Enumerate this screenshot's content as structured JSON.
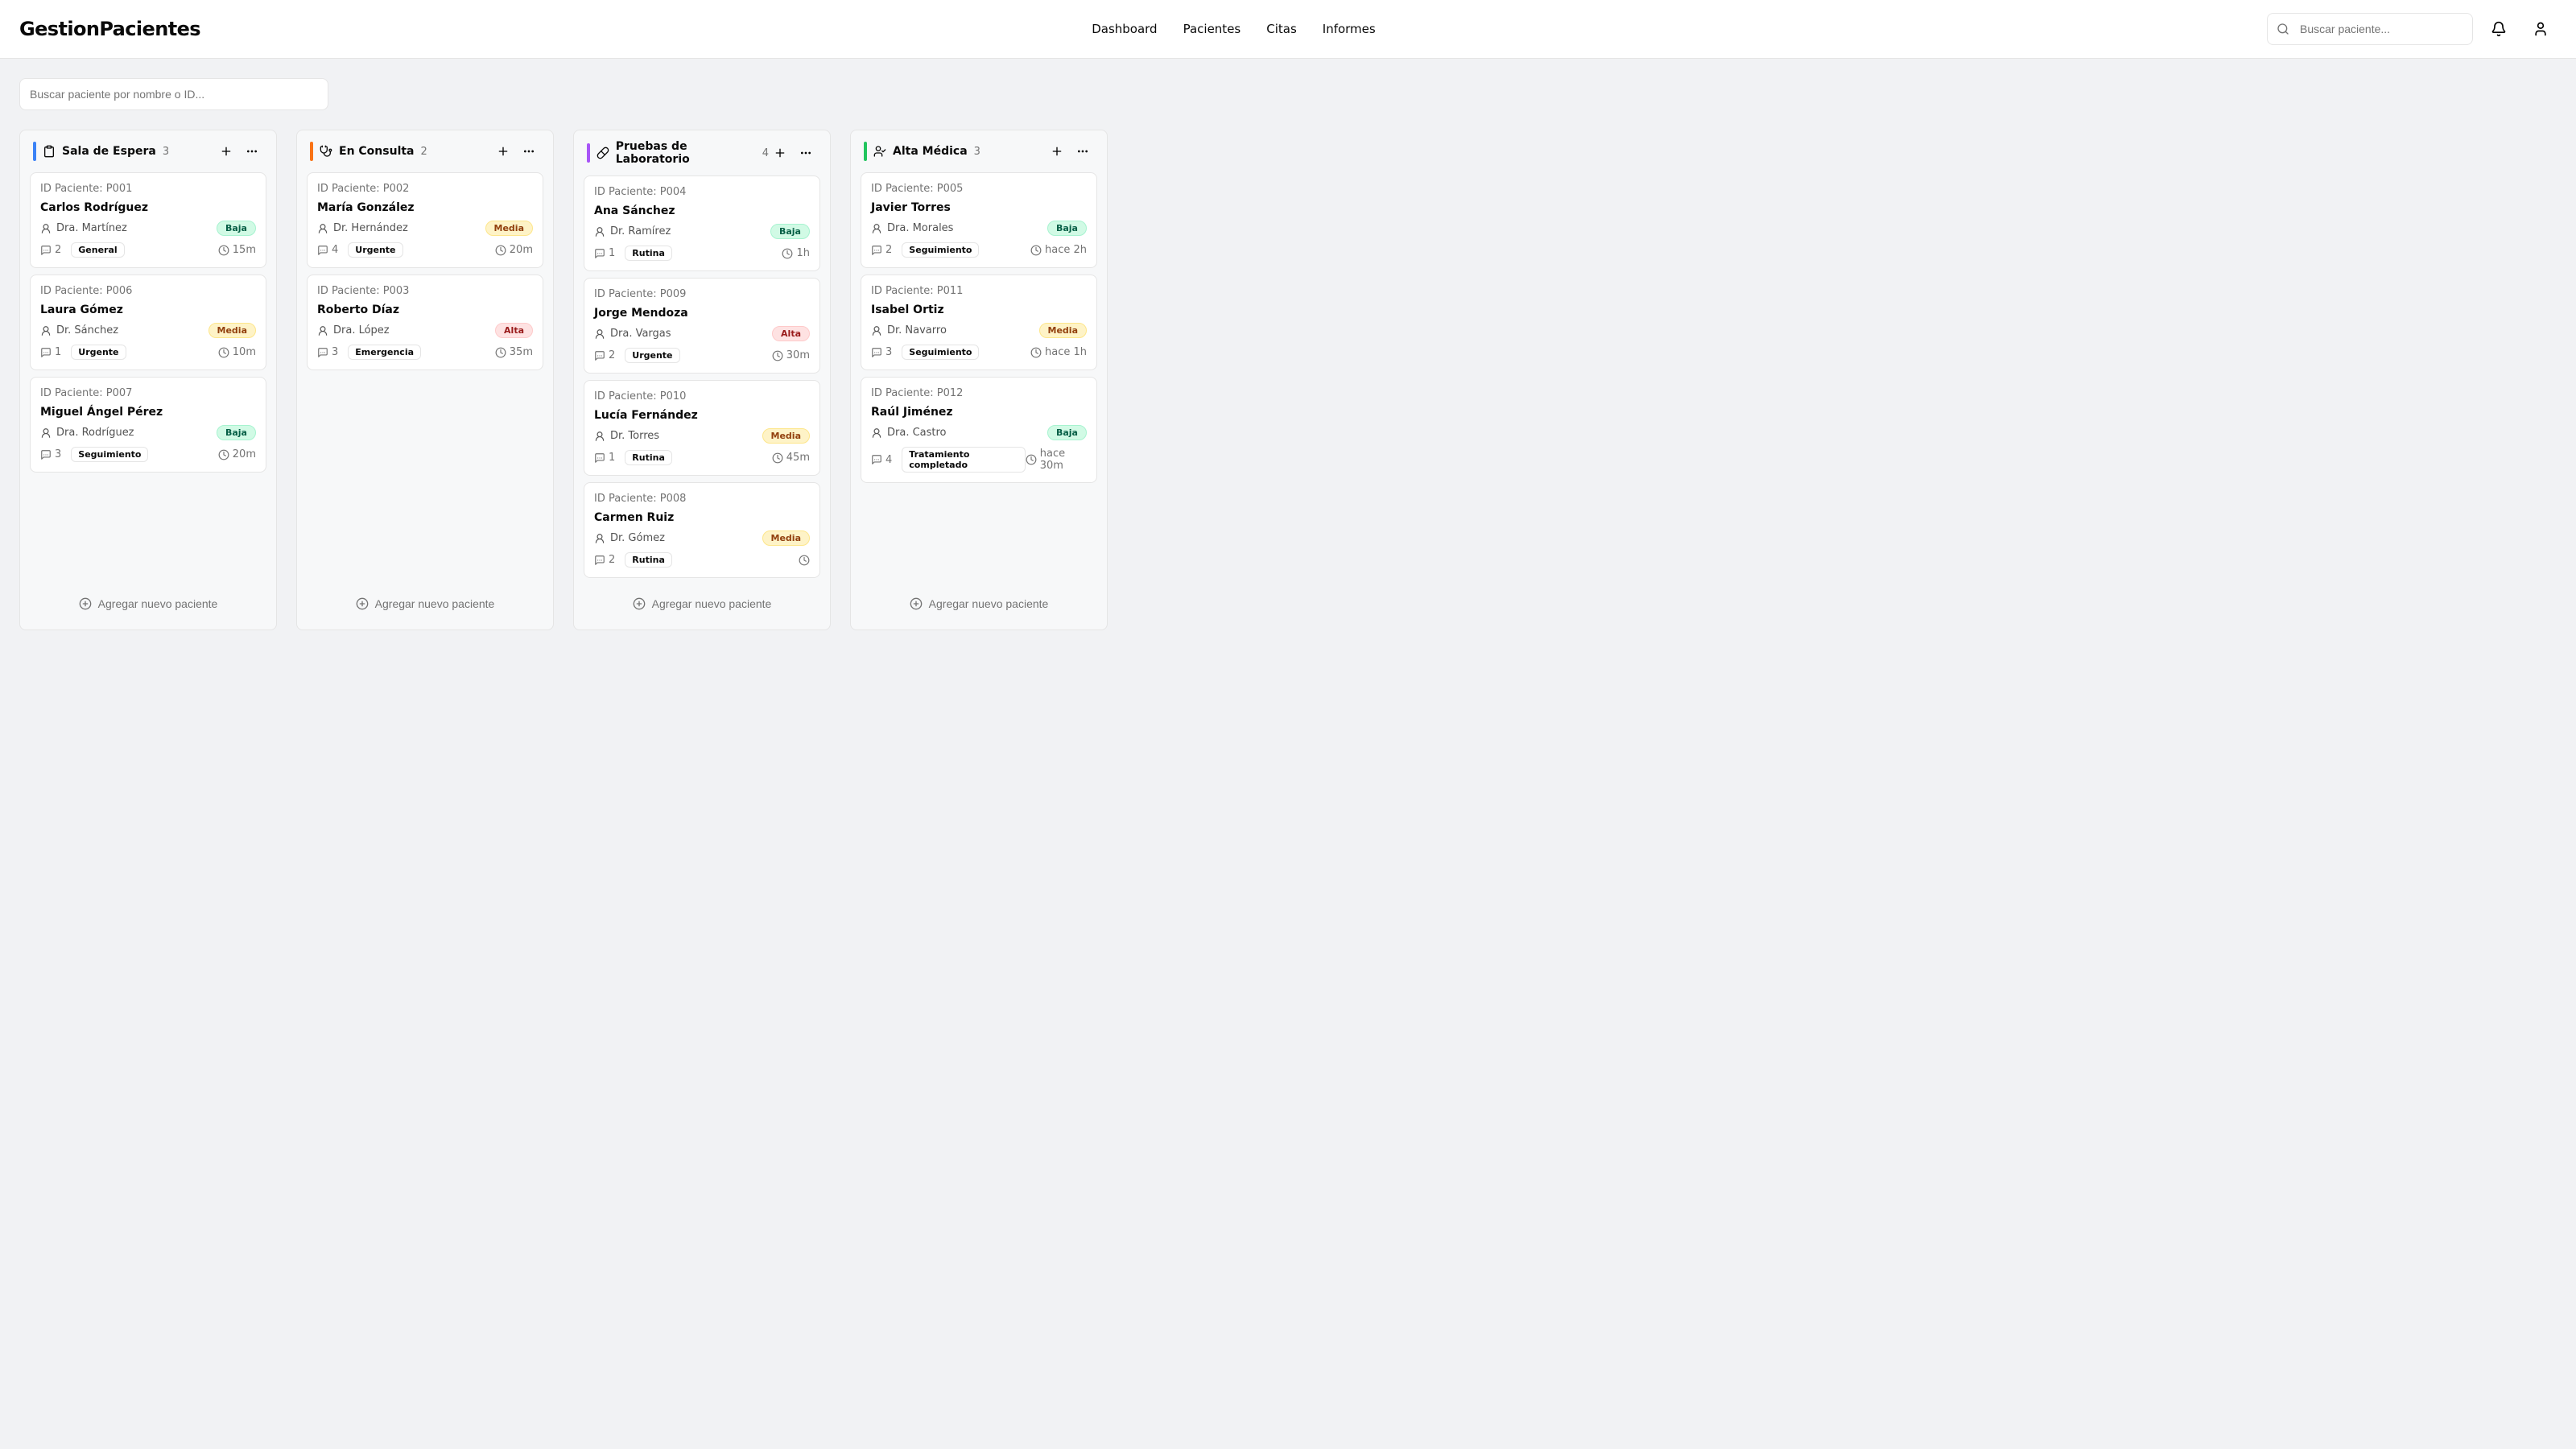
{
  "app": {
    "title": "GestionPacientes"
  },
  "nav": {
    "dashboard": "Dashboard",
    "patients": "Pacientes",
    "appointments": "Citas",
    "reports": "Informes"
  },
  "search": {
    "header_placeholder": "Buscar paciente...",
    "filter_placeholder": "Buscar paciente por nombre o ID..."
  },
  "common": {
    "add_patient": "Agregar nuevo paciente",
    "id_prefix": "ID Paciente: "
  },
  "priorities": {
    "Alta": "Alta",
    "Media": "Media",
    "Baja": "Baja"
  },
  "columns": [
    {
      "id": "waiting",
      "title": "Sala de Espera",
      "color": "#3b82f6",
      "icon": "clipboard",
      "count": 3,
      "cards": [
        {
          "pid": "P001",
          "name": "Carlos Rodríguez",
          "doctor": "Dra. Martínez",
          "priority": "Baja",
          "comments": 2,
          "category": "General",
          "time": "15m"
        },
        {
          "pid": "P006",
          "name": "Laura Gómez",
          "doctor": "Dr. Sánchez",
          "priority": "Media",
          "comments": 1,
          "category": "Urgente",
          "time": "10m"
        },
        {
          "pid": "P007",
          "name": "Miguel Ángel Pérez",
          "doctor": "Dra. Rodríguez",
          "priority": "Baja",
          "comments": 3,
          "category": "Seguimiento",
          "time": "20m"
        }
      ]
    },
    {
      "id": "consultation",
      "title": "En Consulta",
      "color": "#f97316",
      "icon": "stethoscope",
      "count": 2,
      "cards": [
        {
          "pid": "P002",
          "name": "María González",
          "doctor": "Dr. Hernández",
          "priority": "Media",
          "comments": 4,
          "category": "Urgente",
          "time": "20m"
        },
        {
          "pid": "P003",
          "name": "Roberto Díaz",
          "doctor": "Dra. López",
          "priority": "Alta",
          "comments": 3,
          "category": "Emergencia",
          "time": "35m"
        }
      ]
    },
    {
      "id": "lab",
      "title": "Pruebas de Laboratorio",
      "color": "#a855f7",
      "icon": "pill",
      "count": 4,
      "cards": [
        {
          "pid": "P004",
          "name": "Ana Sánchez",
          "doctor": "Dr. Ramírez",
          "priority": "Baja",
          "comments": 1,
          "category": "Rutina",
          "time": "1h"
        },
        {
          "pid": "P009",
          "name": "Jorge Mendoza",
          "doctor": "Dra. Vargas",
          "priority": "Alta",
          "comments": 2,
          "category": "Urgente",
          "time": "30m"
        },
        {
          "pid": "P010",
          "name": "Lucía Fernández",
          "doctor": "Dr. Torres",
          "priority": "Media",
          "comments": 1,
          "category": "Rutina",
          "time": "45m"
        },
        {
          "pid": "P008",
          "name": "Carmen Ruiz",
          "doctor": "Dr. Gómez",
          "priority": "Media",
          "comments": 2,
          "category": "Rutina",
          "time": ""
        }
      ]
    },
    {
      "id": "discharge",
      "title": "Alta Médica",
      "color": "#22c55e",
      "icon": "user-check",
      "count": 3,
      "cards": [
        {
          "pid": "P005",
          "name": "Javier Torres",
          "doctor": "Dra. Morales",
          "priority": "Baja",
          "comments": 2,
          "category": "Seguimiento",
          "time": "hace 2h"
        },
        {
          "pid": "P011",
          "name": "Isabel Ortiz",
          "doctor": "Dr. Navarro",
          "priority": "Media",
          "comments": 3,
          "category": "Seguimiento",
          "time": "hace 1h"
        },
        {
          "pid": "P012",
          "name": "Raúl Jiménez",
          "doctor": "Dra. Castro",
          "priority": "Baja",
          "comments": 4,
          "category": "Tratamiento completado",
          "time": "hace 30m"
        }
      ]
    }
  ]
}
